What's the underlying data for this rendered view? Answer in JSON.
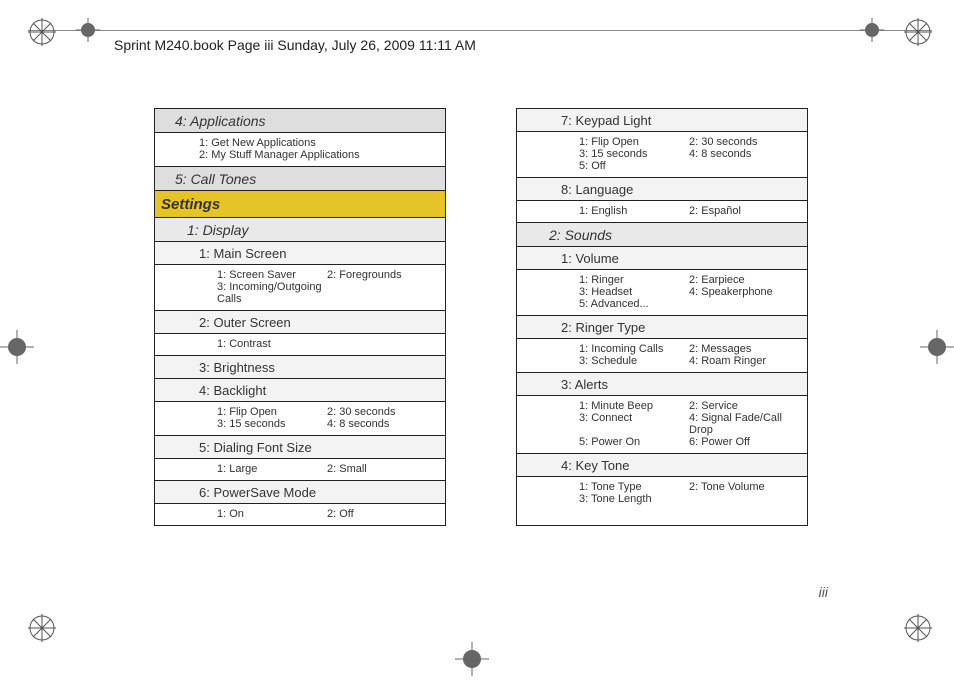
{
  "header": {
    "text": "Sprint M240.book  Page iii  Sunday, July 26, 2009  11:11 AM"
  },
  "page_number": "iii",
  "left_column": [
    {
      "type": "hdr",
      "level": "a",
      "text": "4: Applications"
    },
    {
      "type": "items",
      "pad": "c",
      "cols": 1,
      "list": [
        "1: Get New Applications",
        "2: My Stuff Manager Applications"
      ]
    },
    {
      "type": "hdr",
      "level": "a",
      "text": "5: Call Tones"
    },
    {
      "type": "hdr",
      "level": "0",
      "text": "Settings"
    },
    {
      "type": "hdr",
      "level": "b",
      "text": "1: Display"
    },
    {
      "type": "hdr",
      "level": "c",
      "text": "1: Main Screen"
    },
    {
      "type": "items",
      "pad": "d",
      "cols": 2,
      "list": [
        "1: Screen Saver",
        "2: Foregrounds",
        "3: Incoming/Outgoing Calls",
        ""
      ]
    },
    {
      "type": "hdr",
      "level": "c",
      "text": "2: Outer Screen"
    },
    {
      "type": "items",
      "pad": "d",
      "cols": 2,
      "list": [
        "1: Contrast",
        ""
      ]
    },
    {
      "type": "hdr",
      "level": "c",
      "text": "3: Brightness"
    },
    {
      "type": "hdr",
      "level": "c",
      "text": "4: Backlight"
    },
    {
      "type": "items",
      "pad": "d",
      "cols": 2,
      "list": [
        "1: Flip Open",
        "2: 30 seconds",
        "3: 15 seconds",
        "4: 8 seconds"
      ]
    },
    {
      "type": "hdr",
      "level": "c",
      "text": "5: Dialing Font Size"
    },
    {
      "type": "items",
      "pad": "d",
      "cols": 2,
      "list": [
        "1: Large",
        "2: Small"
      ]
    },
    {
      "type": "hdr",
      "level": "c",
      "text": "6: PowerSave Mode"
    },
    {
      "type": "items",
      "pad": "d",
      "cols": 2,
      "list": [
        "1: On",
        "2: Off"
      ]
    }
  ],
  "right_column": [
    {
      "type": "hdr",
      "level": "c",
      "text": "7: Keypad Light"
    },
    {
      "type": "items",
      "pad": "d",
      "cols": 2,
      "list": [
        "1: Flip Open",
        "2: 30 seconds",
        "3: 15 seconds",
        "4: 8 seconds",
        "5: Off",
        ""
      ]
    },
    {
      "type": "hdr",
      "level": "c",
      "text": "8: Language"
    },
    {
      "type": "items",
      "pad": "d",
      "cols": 2,
      "list": [
        "1: English",
        "2: Español"
      ]
    },
    {
      "type": "hdr",
      "level": "b",
      "text": "2: Sounds"
    },
    {
      "type": "hdr",
      "level": "c",
      "text": "1: Volume"
    },
    {
      "type": "items",
      "pad": "d",
      "cols": 2,
      "list": [
        "1: Ringer",
        "2: Earpiece",
        "3: Headset",
        "4: Speakerphone",
        "5: Advanced...",
        ""
      ]
    },
    {
      "type": "hdr",
      "level": "c",
      "text": "2: Ringer Type"
    },
    {
      "type": "items",
      "pad": "d",
      "cols": 2,
      "list": [
        "1: Incoming Calls",
        "2: Messages",
        "3: Schedule",
        "4: Roam Ringer"
      ]
    },
    {
      "type": "hdr",
      "level": "c",
      "text": "3: Alerts"
    },
    {
      "type": "items",
      "pad": "d",
      "cols": 2,
      "list": [
        "1: Minute Beep",
        "2: Service",
        "3: Connect",
        "4: Signal Fade/Call Drop",
        "5: Power On",
        "6: Power Off"
      ]
    },
    {
      "type": "hdr",
      "level": "c",
      "text": "4: Key Tone"
    },
    {
      "type": "items",
      "pad": "d",
      "cols": 2,
      "list": [
        "1: Tone Type",
        "2: Tone Volume",
        "3: Tone Length",
        ""
      ]
    }
  ]
}
